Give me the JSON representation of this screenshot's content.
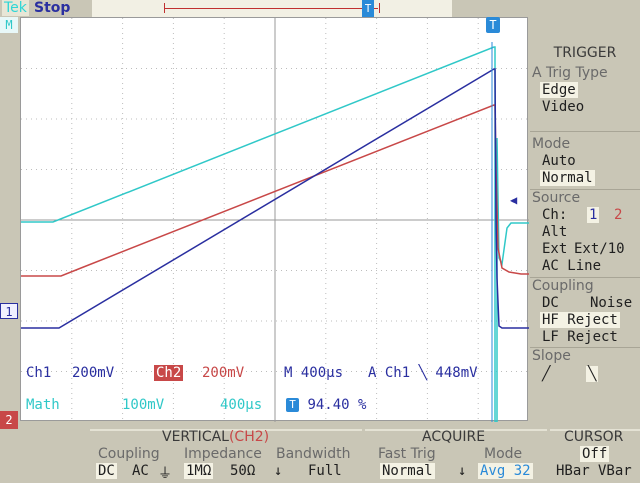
{
  "status": {
    "brand": "Tek",
    "run_state": "Stop"
  },
  "markers": {
    "math": "M",
    "ch1": "1",
    "ch2": "2",
    "trigger_t": "T"
  },
  "readouts": {
    "ch1_label": "Ch1",
    "ch1_scale": "200mV",
    "ch2_label": "Ch2",
    "ch2_scale": "200mV",
    "timebase": "M 400µs",
    "trigger": "A  Ch1  ╲  448mV",
    "math_label": "Math",
    "math_scale": "100mV",
    "math_time": "400µs",
    "trigger_position": "94.40 %"
  },
  "trigger_menu": {
    "title": "TRIGGER",
    "trig_type_label": "A Trig Type",
    "type_edge": "Edge",
    "type_video": "Video",
    "mode_label": "Mode",
    "mode_auto": "Auto",
    "mode_normal": "Normal",
    "source_label": "Source",
    "source_ch": "Ch:",
    "source_ch1": "1",
    "source_ch2": "2",
    "source_alt": "Alt",
    "source_ext": "Ext",
    "source_ext10": "Ext/10",
    "source_acline": "AC Line",
    "coupling_label": "Coupling",
    "coupling_dc": "DC",
    "coupling_noise": "Noise",
    "coupling_hf": "HF Reject",
    "coupling_lf": "LF Reject",
    "slope_label": "Slope",
    "slope_rise": "╱",
    "slope_fall": "╲"
  },
  "bottom_menu": {
    "vertical_title": "VERTICAL",
    "vertical_channel": "(CH2)",
    "coupling_label": "Coupling",
    "coupling_dc": "DC",
    "coupling_ac": "AC",
    "coupling_gnd": "⏚",
    "impedance_label": "Impedance",
    "imp_1m": "1MΩ",
    "imp_50": "50Ω",
    "bandwidth_label": "Bandwidth",
    "bandwidth_value": "Full",
    "acquire_title": "ACQUIRE",
    "fasttrig_label": "Fast Trig",
    "fasttrig_value": "Normal",
    "mode_label": "Mode",
    "mode_value": "Avg 32",
    "cursor_title": "CURSOR",
    "cursor_state": "Off",
    "cursor_hbar": "HBar",
    "cursor_vbar": "VBar",
    "down_arrow": "↓"
  },
  "colors": {
    "ch1": "#2a2fa0",
    "ch2": "#c84848",
    "math": "#30c8c8",
    "trigger": "#2a8ad8"
  }
}
